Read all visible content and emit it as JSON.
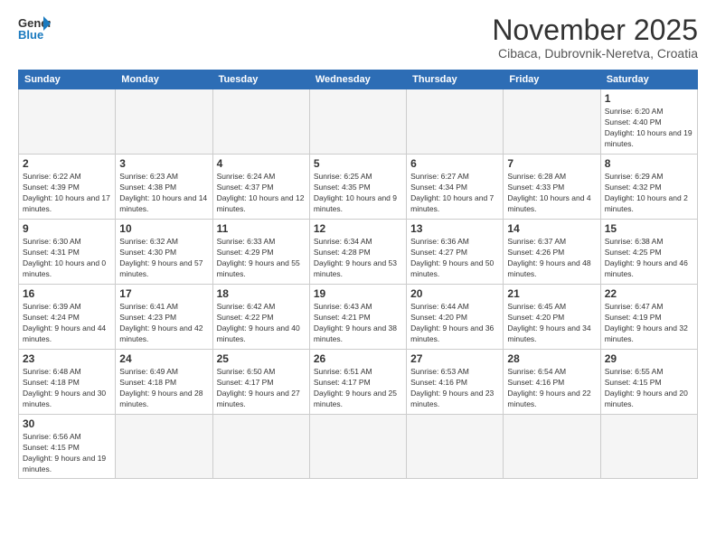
{
  "header": {
    "logo_text_regular": "General",
    "logo_text_blue": "Blue",
    "month_title": "November 2025",
    "subtitle": "Cibaca, Dubrovnik-Neretva, Croatia"
  },
  "weekdays": [
    "Sunday",
    "Monday",
    "Tuesday",
    "Wednesday",
    "Thursday",
    "Friday",
    "Saturday"
  ],
  "weeks": [
    [
      {
        "day": "",
        "info": ""
      },
      {
        "day": "",
        "info": ""
      },
      {
        "day": "",
        "info": ""
      },
      {
        "day": "",
        "info": ""
      },
      {
        "day": "",
        "info": ""
      },
      {
        "day": "",
        "info": ""
      },
      {
        "day": "1",
        "info": "Sunrise: 6:20 AM\nSunset: 4:40 PM\nDaylight: 10 hours and 19 minutes."
      }
    ],
    [
      {
        "day": "2",
        "info": "Sunrise: 6:22 AM\nSunset: 4:39 PM\nDaylight: 10 hours and 17 minutes."
      },
      {
        "day": "3",
        "info": "Sunrise: 6:23 AM\nSunset: 4:38 PM\nDaylight: 10 hours and 14 minutes."
      },
      {
        "day": "4",
        "info": "Sunrise: 6:24 AM\nSunset: 4:37 PM\nDaylight: 10 hours and 12 minutes."
      },
      {
        "day": "5",
        "info": "Sunrise: 6:25 AM\nSunset: 4:35 PM\nDaylight: 10 hours and 9 minutes."
      },
      {
        "day": "6",
        "info": "Sunrise: 6:27 AM\nSunset: 4:34 PM\nDaylight: 10 hours and 7 minutes."
      },
      {
        "day": "7",
        "info": "Sunrise: 6:28 AM\nSunset: 4:33 PM\nDaylight: 10 hours and 4 minutes."
      },
      {
        "day": "8",
        "info": "Sunrise: 6:29 AM\nSunset: 4:32 PM\nDaylight: 10 hours and 2 minutes."
      }
    ],
    [
      {
        "day": "9",
        "info": "Sunrise: 6:30 AM\nSunset: 4:31 PM\nDaylight: 10 hours and 0 minutes."
      },
      {
        "day": "10",
        "info": "Sunrise: 6:32 AM\nSunset: 4:30 PM\nDaylight: 9 hours and 57 minutes."
      },
      {
        "day": "11",
        "info": "Sunrise: 6:33 AM\nSunset: 4:29 PM\nDaylight: 9 hours and 55 minutes."
      },
      {
        "day": "12",
        "info": "Sunrise: 6:34 AM\nSunset: 4:28 PM\nDaylight: 9 hours and 53 minutes."
      },
      {
        "day": "13",
        "info": "Sunrise: 6:36 AM\nSunset: 4:27 PM\nDaylight: 9 hours and 50 minutes."
      },
      {
        "day": "14",
        "info": "Sunrise: 6:37 AM\nSunset: 4:26 PM\nDaylight: 9 hours and 48 minutes."
      },
      {
        "day": "15",
        "info": "Sunrise: 6:38 AM\nSunset: 4:25 PM\nDaylight: 9 hours and 46 minutes."
      }
    ],
    [
      {
        "day": "16",
        "info": "Sunrise: 6:39 AM\nSunset: 4:24 PM\nDaylight: 9 hours and 44 minutes."
      },
      {
        "day": "17",
        "info": "Sunrise: 6:41 AM\nSunset: 4:23 PM\nDaylight: 9 hours and 42 minutes."
      },
      {
        "day": "18",
        "info": "Sunrise: 6:42 AM\nSunset: 4:22 PM\nDaylight: 9 hours and 40 minutes."
      },
      {
        "day": "19",
        "info": "Sunrise: 6:43 AM\nSunset: 4:21 PM\nDaylight: 9 hours and 38 minutes."
      },
      {
        "day": "20",
        "info": "Sunrise: 6:44 AM\nSunset: 4:20 PM\nDaylight: 9 hours and 36 minutes."
      },
      {
        "day": "21",
        "info": "Sunrise: 6:45 AM\nSunset: 4:20 PM\nDaylight: 9 hours and 34 minutes."
      },
      {
        "day": "22",
        "info": "Sunrise: 6:47 AM\nSunset: 4:19 PM\nDaylight: 9 hours and 32 minutes."
      }
    ],
    [
      {
        "day": "23",
        "info": "Sunrise: 6:48 AM\nSunset: 4:18 PM\nDaylight: 9 hours and 30 minutes."
      },
      {
        "day": "24",
        "info": "Sunrise: 6:49 AM\nSunset: 4:18 PM\nDaylight: 9 hours and 28 minutes."
      },
      {
        "day": "25",
        "info": "Sunrise: 6:50 AM\nSunset: 4:17 PM\nDaylight: 9 hours and 27 minutes."
      },
      {
        "day": "26",
        "info": "Sunrise: 6:51 AM\nSunset: 4:17 PM\nDaylight: 9 hours and 25 minutes."
      },
      {
        "day": "27",
        "info": "Sunrise: 6:53 AM\nSunset: 4:16 PM\nDaylight: 9 hours and 23 minutes."
      },
      {
        "day": "28",
        "info": "Sunrise: 6:54 AM\nSunset: 4:16 PM\nDaylight: 9 hours and 22 minutes."
      },
      {
        "day": "29",
        "info": "Sunrise: 6:55 AM\nSunset: 4:15 PM\nDaylight: 9 hours and 20 minutes."
      }
    ],
    [
      {
        "day": "30",
        "info": "Sunrise: 6:56 AM\nSunset: 4:15 PM\nDaylight: 9 hours and 19 minutes."
      },
      {
        "day": "",
        "info": ""
      },
      {
        "day": "",
        "info": ""
      },
      {
        "day": "",
        "info": ""
      },
      {
        "day": "",
        "info": ""
      },
      {
        "day": "",
        "info": ""
      },
      {
        "day": "",
        "info": ""
      }
    ]
  ]
}
